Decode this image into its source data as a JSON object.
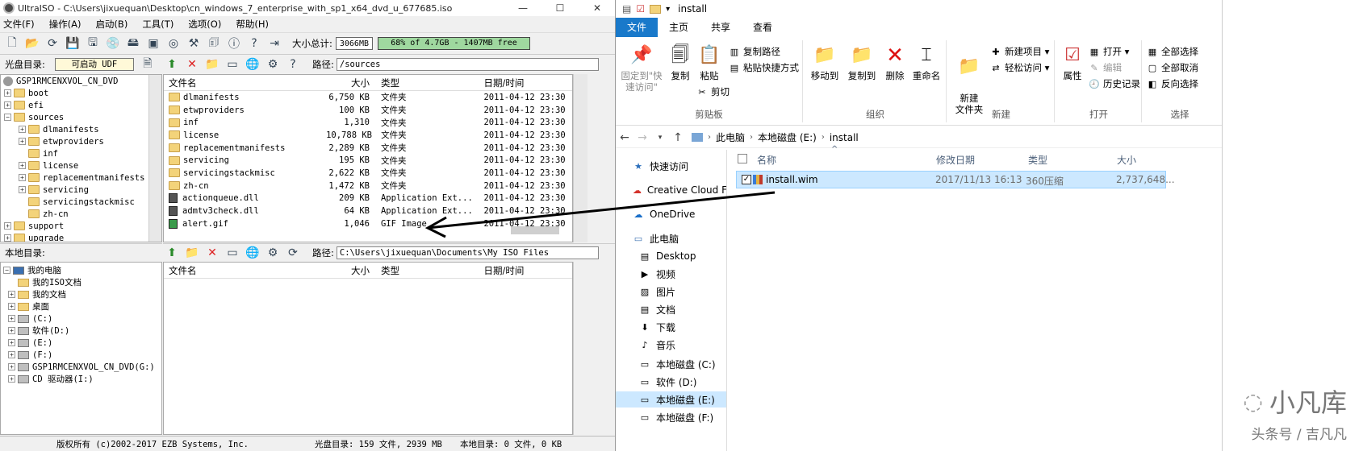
{
  "ultraiso": {
    "title": "UltraISO - C:\\Users\\jixuequan\\Desktop\\cn_windows_7_enterprise_with_sp1_x64_dvd_u_677685.iso",
    "window_buttons": {
      "minimize": "—",
      "maximize": "☐",
      "close": "✕"
    },
    "menu": [
      "文件(F)",
      "操作(A)",
      "启动(B)",
      "工具(T)",
      "选项(O)",
      "帮助(H)"
    ],
    "size_total_label": "大小总计:",
    "size_total_value": "3066MB",
    "capacity_bar": "68% of 4.7GB - 1407MB free",
    "capacity_fraction": 0.68,
    "disc_dir_label": "光盘目录:",
    "boot_label": "可启动 UDF",
    "path_label": "路径:",
    "disc_path": "/sources",
    "tree_root": "GSP1RMCENXVOL_CN_DVD",
    "tree_items": [
      {
        "label": "boot",
        "level": 1,
        "expander": "+"
      },
      {
        "label": "efi",
        "level": 1,
        "expander": "+"
      },
      {
        "label": "sources",
        "level": 1,
        "expander": "−"
      },
      {
        "label": "dlmanifests",
        "level": 2,
        "expander": "+"
      },
      {
        "label": "etwproviders",
        "level": 2,
        "expander": "+"
      },
      {
        "label": "inf",
        "level": 2,
        "expander": ""
      },
      {
        "label": "license",
        "level": 2,
        "expander": "+"
      },
      {
        "label": "replacementmanifests",
        "level": 2,
        "expander": "+"
      },
      {
        "label": "servicing",
        "level": 2,
        "expander": "+"
      },
      {
        "label": "servicingstackmisc",
        "level": 2,
        "expander": ""
      },
      {
        "label": "zh-cn",
        "level": 2,
        "expander": ""
      },
      {
        "label": "support",
        "level": 1,
        "expander": "+"
      },
      {
        "label": "upgrade",
        "level": 1,
        "expander": "+"
      }
    ],
    "columns": {
      "name": "文件名",
      "size": "大小",
      "type": "类型",
      "date": "日期/时间"
    },
    "files": [
      {
        "name": "dlmanifests",
        "size": "6,750 KB",
        "type": "文件夹",
        "date": "2011-04-12 23:30",
        "icon": "folder"
      },
      {
        "name": "etwproviders",
        "size": "100 KB",
        "type": "文件夹",
        "date": "2011-04-12 23:30",
        "icon": "folder"
      },
      {
        "name": "inf",
        "size": "1,310",
        "type": "文件夹",
        "date": "2011-04-12 23:30",
        "icon": "folder"
      },
      {
        "name": "license",
        "size": "10,788 KB",
        "type": "文件夹",
        "date": "2011-04-12 23:30",
        "icon": "folder"
      },
      {
        "name": "replacementmanifests",
        "size": "2,289 KB",
        "type": "文件夹",
        "date": "2011-04-12 23:30",
        "icon": "folder"
      },
      {
        "name": "servicing",
        "size": "195 KB",
        "type": "文件夹",
        "date": "2011-04-12 23:30",
        "icon": "folder"
      },
      {
        "name": "servicingstackmisc",
        "size": "2,622 KB",
        "type": "文件夹",
        "date": "2011-04-12 23:30",
        "icon": "folder"
      },
      {
        "name": "zh-cn",
        "size": "1,472 KB",
        "type": "文件夹",
        "date": "2011-04-12 23:30",
        "icon": "folder"
      },
      {
        "name": "actionqueue.dll",
        "size": "209 KB",
        "type": "Application Ext...",
        "date": "2011-04-12 23:30",
        "icon": "dll"
      },
      {
        "name": "admtv3check.dll",
        "size": "64 KB",
        "type": "Application Ext...",
        "date": "2011-04-12 23:30",
        "icon": "dll"
      },
      {
        "name": "alert.gif",
        "size": "1,046",
        "type": "GIF Image",
        "date": "2011-04-12 23:30",
        "icon": "gif"
      }
    ],
    "local_dir_label": "本地目录:",
    "local_path": "C:\\Users\\jixuequan\\Documents\\My ISO Files",
    "local_tree": [
      {
        "label": "我的电脑",
        "level": 0,
        "expander": "−"
      },
      {
        "label": "我的ISO文档",
        "level": 1,
        "expander": ""
      },
      {
        "label": "我的文档",
        "level": 1,
        "expander": "+"
      },
      {
        "label": "桌面",
        "level": 1,
        "expander": "+"
      },
      {
        "label": "(C:)",
        "level": 1,
        "expander": "+"
      },
      {
        "label": "软件(D:)",
        "level": 1,
        "expander": "+"
      },
      {
        "label": "(E:)",
        "level": 1,
        "expander": "+"
      },
      {
        "label": "(F:)",
        "level": 1,
        "expander": "+"
      },
      {
        "label": "GSP1RMCENXVOL_CN_DVD(G:)",
        "level": 1,
        "expander": "+"
      },
      {
        "label": "CD 驱动器(I:)",
        "level": 1,
        "expander": "+"
      }
    ],
    "status": {
      "copyright": "版权所有 (c)2002-2017 EZB Systems, Inc.",
      "disc": "光盘目录: 159 文件, 2939 MB",
      "local": "本地目录: 0 文件, 0 KB"
    }
  },
  "explorer": {
    "title": "install",
    "tabs": [
      "文件",
      "主页",
      "共享",
      "查看"
    ],
    "active_tab": 1,
    "ribbon": {
      "clipboard": {
        "pin": "固定到\"快速访问\"",
        "copy": "复制",
        "paste": "粘贴",
        "copy_path": "复制路径",
        "paste_shortcut": "粘贴快捷方式",
        "cut": "剪切",
        "group": "剪贴板"
      },
      "organize": {
        "move_to": "移动到",
        "copy_to": "复制到",
        "delete": "删除",
        "rename": "重命名",
        "group": "组织"
      },
      "new": {
        "new_folder": "新建\n文件夹",
        "new_item": "新建项目 ▾",
        "easy_access": "轻松访问 ▾",
        "group": "新建"
      },
      "open": {
        "properties": "属性",
        "open": "打开 ▾",
        "edit": "编辑",
        "history": "历史记录",
        "group": "打开"
      },
      "select": {
        "select_all": "全部选择",
        "select_none": "全部取消",
        "invert": "反向选择",
        "group": "选择"
      }
    },
    "breadcrumb": [
      "此电脑",
      "本地磁盘 (E:)",
      "install"
    ],
    "nav": [
      {
        "label": "快速访问",
        "icon": "star-icon",
        "selected": false
      },
      {
        "label": "Creative Cloud F",
        "icon": "cloud-icon",
        "selected": false
      },
      {
        "label": "OneDrive",
        "icon": "onedrive-icon",
        "selected": false
      },
      {
        "label": "此电脑",
        "icon": "pc-icon",
        "selected": false
      },
      {
        "label": "Desktop",
        "icon": "folder-icon",
        "selected": false
      },
      {
        "label": "视频",
        "icon": "video-icon",
        "selected": false
      },
      {
        "label": "图片",
        "icon": "picture-icon",
        "selected": false
      },
      {
        "label": "文档",
        "icon": "document-icon",
        "selected": false
      },
      {
        "label": "下载",
        "icon": "download-icon",
        "selected": false
      },
      {
        "label": "音乐",
        "icon": "music-icon",
        "selected": false
      },
      {
        "label": "本地磁盘 (C:)",
        "icon": "drive-icon",
        "selected": false
      },
      {
        "label": "软件 (D:)",
        "icon": "drive-icon",
        "selected": false
      },
      {
        "label": "本地磁盘 (E:)",
        "icon": "drive-icon",
        "selected": true
      },
      {
        "label": "本地磁盘 (F:)",
        "icon": "drive-icon",
        "selected": false
      }
    ],
    "columns": {
      "name": "名称",
      "date": "修改日期",
      "type": "类型",
      "size": "大小"
    },
    "file": {
      "name": "install.wim",
      "date": "2017/11/13 16:13",
      "type": "360压缩",
      "size": "2,737,648..."
    }
  },
  "watermark": {
    "brand": "小凡库",
    "byline": "头条号 / 吉凡凡"
  },
  "colors": {
    "ribbon_blue": "#1979ca",
    "selection": "#cce8ff",
    "capacity_green": "#9fd89f"
  }
}
